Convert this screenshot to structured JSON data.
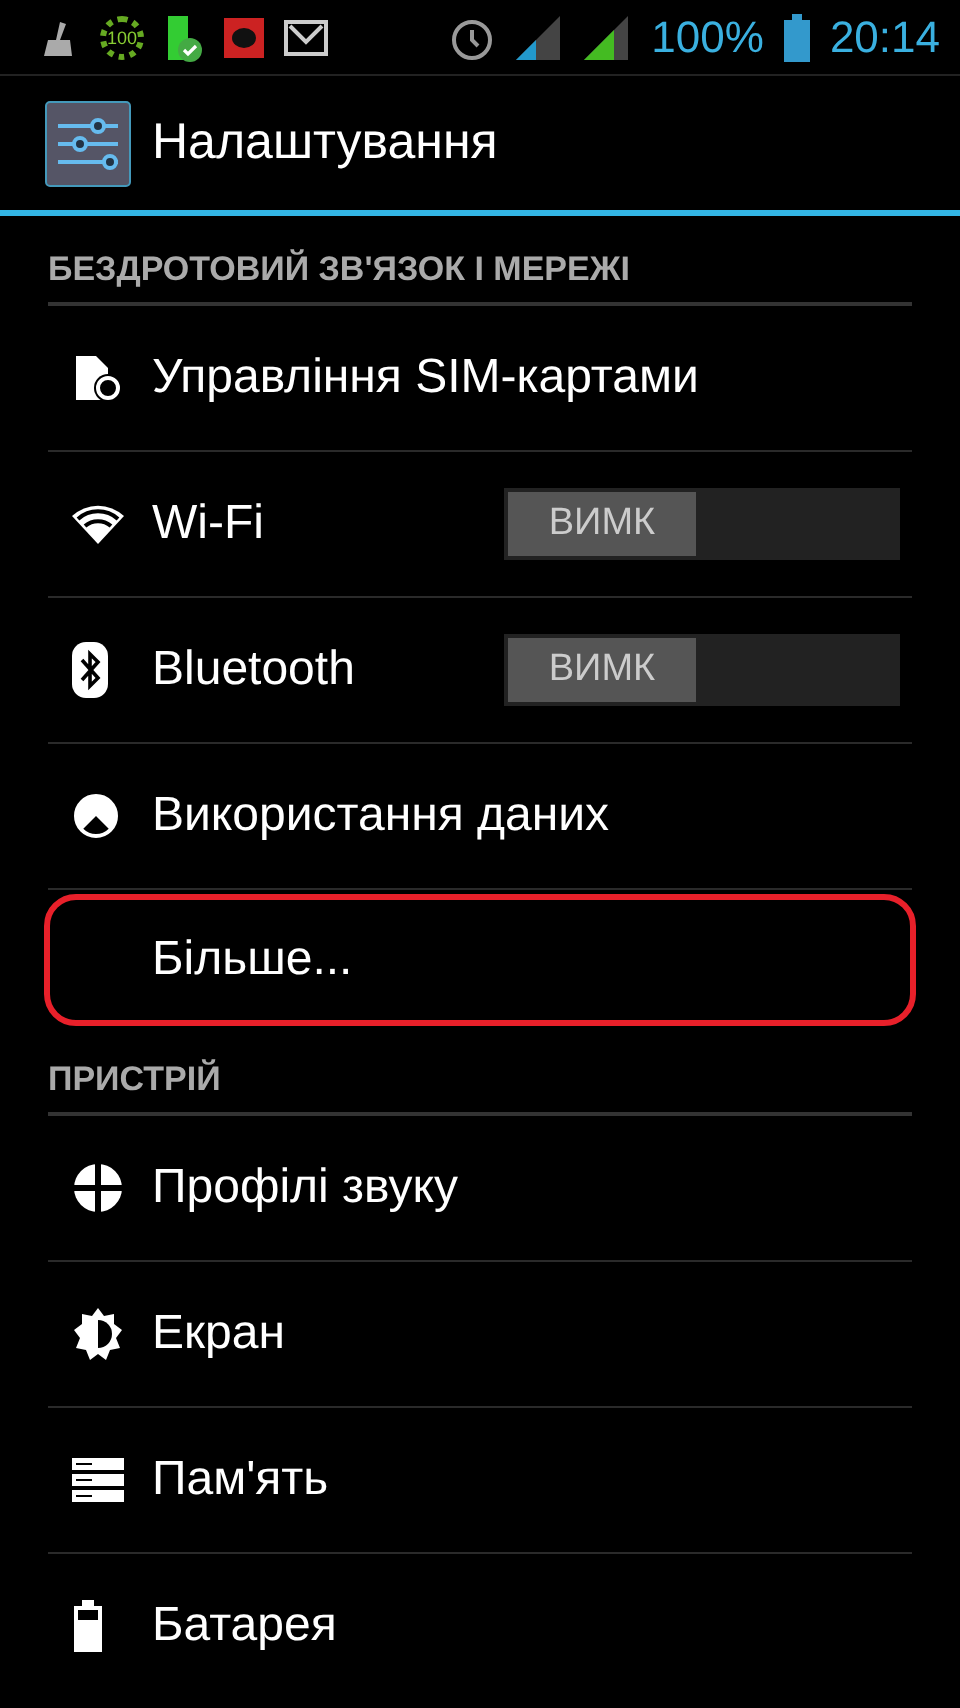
{
  "status_bar": {
    "badge": "100",
    "battery": "100%",
    "time": "20:14"
  },
  "action_bar": {
    "title": "Налаштування"
  },
  "sections": [
    {
      "title": "БЕЗДРОТОВИЙ ЗВ'ЯЗОК І МЕРЕЖІ",
      "items": [
        {
          "label": "Управління SIM-картами",
          "kind": "plain",
          "highlighted": false
        },
        {
          "label": "Wi-Fi",
          "kind": "switch",
          "on": false,
          "switch_label": "ВИМК",
          "highlighted": false
        },
        {
          "label": "Bluetooth",
          "kind": "switch",
          "on": false,
          "switch_label": "ВИМК",
          "highlighted": false
        },
        {
          "label": "Використання даних",
          "kind": "plain",
          "highlighted": false
        },
        {
          "label": "Більше...",
          "kind": "plain",
          "highlighted": true
        }
      ]
    },
    {
      "title": "ПРИСТРІЙ",
      "items": [
        {
          "label": "Профілі звуку",
          "kind": "plain",
          "highlighted": false
        },
        {
          "label": "Екран",
          "kind": "plain",
          "highlighted": false
        },
        {
          "label": "Пам'ять",
          "kind": "plain",
          "highlighted": false
        },
        {
          "label": "Батарея",
          "kind": "plain",
          "highlighted": false
        }
      ]
    }
  ]
}
